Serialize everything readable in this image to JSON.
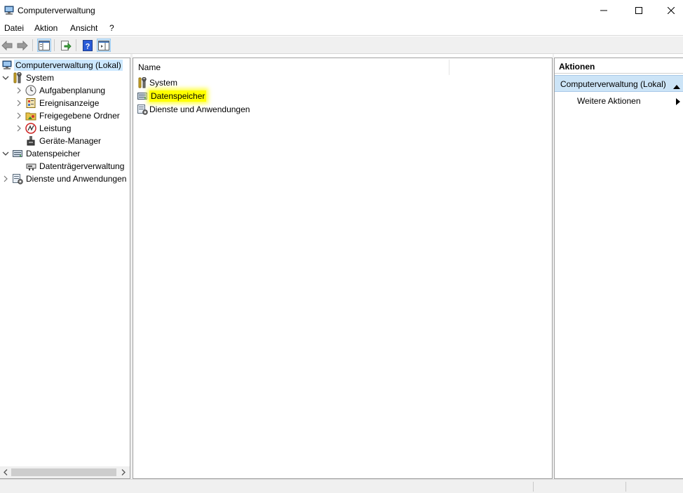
{
  "window": {
    "title": "Computerverwaltung",
    "icon": "computer-management-icon"
  },
  "menu": [
    "Datei",
    "Aktion",
    "Ansicht",
    "?"
  ],
  "toolbar": {
    "buttons": [
      "back-arrow-icon",
      "forward-arrow-icon",
      "show-hide-console-tree-icon",
      "export-list-icon",
      "help-icon",
      "show-hide-action-pane-icon"
    ]
  },
  "tree": {
    "root": "Computerverwaltung (Lokal)",
    "system": "System",
    "aufgabenplanung": "Aufgabenplanung",
    "ereignisanzeige": "Ereignisanzeige",
    "freigegebene_ordner": "Freigegebene Ordner",
    "leistung": "Leistung",
    "geraete_manager": "Geräte-Manager",
    "datenspeicher": "Datenspeicher",
    "datentraegerverwaltung": "Datenträgerverwaltung",
    "dienste": "Dienste und Anwendungen"
  },
  "list": {
    "column_name": "Name",
    "items": [
      "System",
      "Datenspeicher",
      "Dienste und Anwendungen"
    ]
  },
  "actions": {
    "title": "Aktionen",
    "section": "Computerverwaltung (Lokal)",
    "more": "Weitere Aktionen"
  },
  "colors": {
    "selection": "#cce8ff",
    "highlight": "#ffff00",
    "action_section": "#cce4f7"
  }
}
